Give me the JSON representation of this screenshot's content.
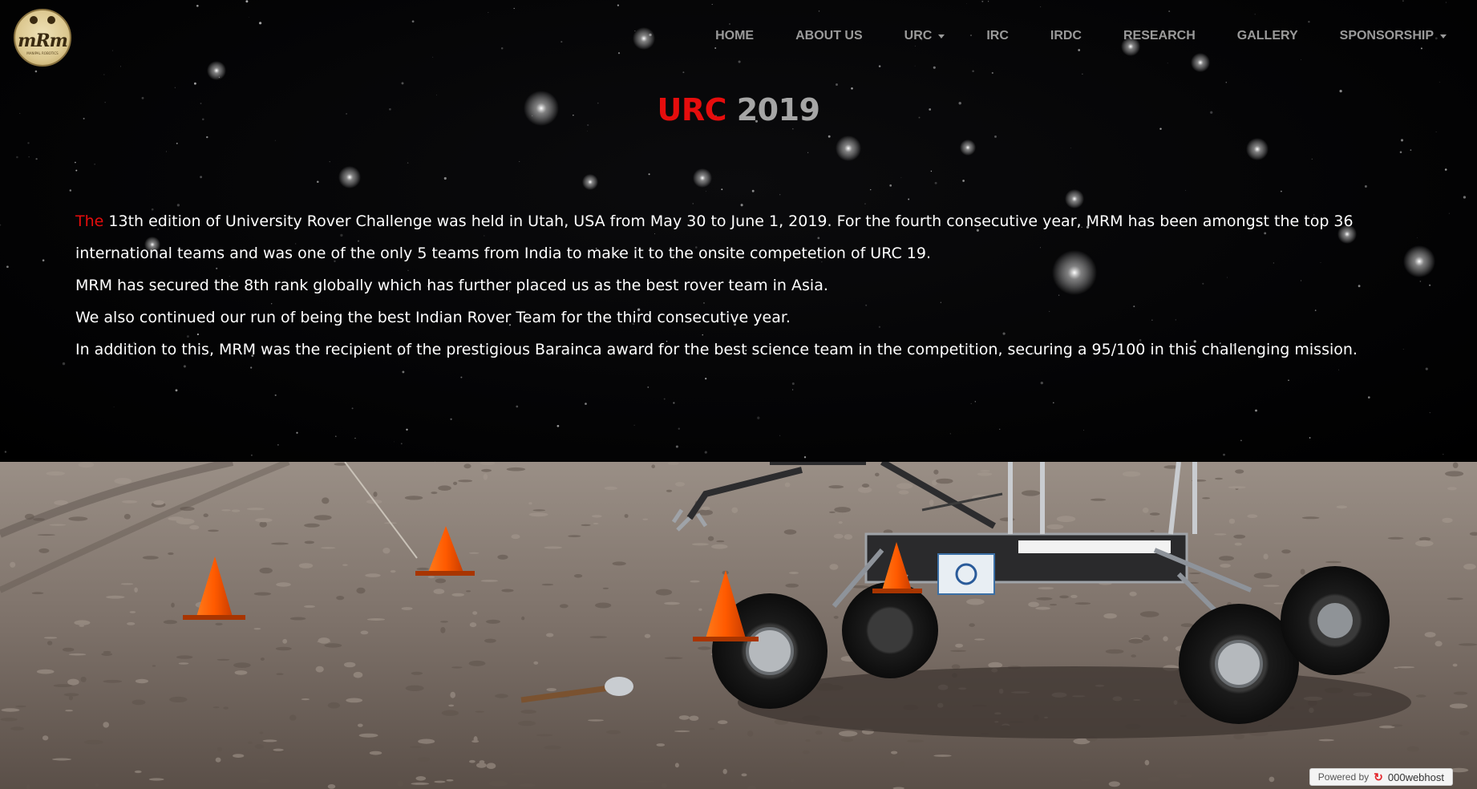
{
  "logo": {
    "text": "mRm",
    "subtext": "MANIPAL ROBOTICS",
    "alt": "MRM logo"
  },
  "nav": {
    "items": [
      {
        "label": "HOME",
        "dropdown": false
      },
      {
        "label": "ABOUT US",
        "dropdown": false
      },
      {
        "label": "URC",
        "dropdown": true
      },
      {
        "label": "IRC",
        "dropdown": false
      },
      {
        "label": "IRDC",
        "dropdown": false
      },
      {
        "label": "RESEARCH",
        "dropdown": false
      },
      {
        "label": "GALLERY",
        "dropdown": false
      },
      {
        "label": "SPONSORSHIP",
        "dropdown": true
      }
    ]
  },
  "heading": {
    "part1": "URC",
    "part2": "2019"
  },
  "content": {
    "lead": "The",
    "line1": "13th edition of University Rover Challenge was held in Utah, USA from May 30 to June 1, 2019. For the fourth consecutive year, MRM has been amongst the top 36 international teams and was one of the only 5 teams from India to make it to the onsite competetion of URC 19.",
    "line2": "MRM has secured the 8th rank globally which has further placed us as the best rover team in Asia.",
    "line3": "We also continued our run of being the best Indian Rover Team for the third consecutive year.",
    "line4": "In addition to this, MRM was the recipient of the prestigious Barainca award for the best science team in the competition, securing a 95/100 in this challenging mission."
  },
  "badge": {
    "powered": "Powered by",
    "host": "000webhost"
  },
  "colors": {
    "accent": "#e60d0d",
    "nav_text": "#9a9a9a",
    "heading_grey": "#a6a6a6",
    "body_text": "#ffffff",
    "background": "#000000"
  },
  "icons": {
    "dropdown": "caret-down-icon",
    "badge": "webhost-swirl-icon"
  }
}
